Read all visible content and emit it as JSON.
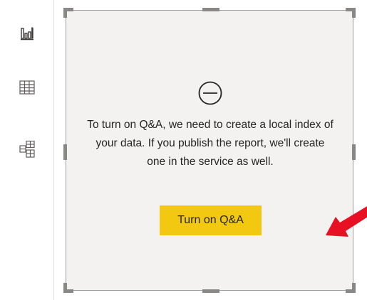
{
  "rail": {
    "items": [
      {
        "icon": "report-view-icon"
      },
      {
        "icon": "data-view-icon"
      },
      {
        "icon": "model-view-icon"
      }
    ]
  },
  "qna": {
    "status_icon": "disabled-circle-icon",
    "message": "To turn on Q&A, we need to create a local index of your data. If you publish the report, we'll create one in the service as well.",
    "button_label": "Turn on Q&A",
    "button_color": "#f2c811",
    "annotation": "red-arrow-icon",
    "annotation_color": "#e81123"
  }
}
